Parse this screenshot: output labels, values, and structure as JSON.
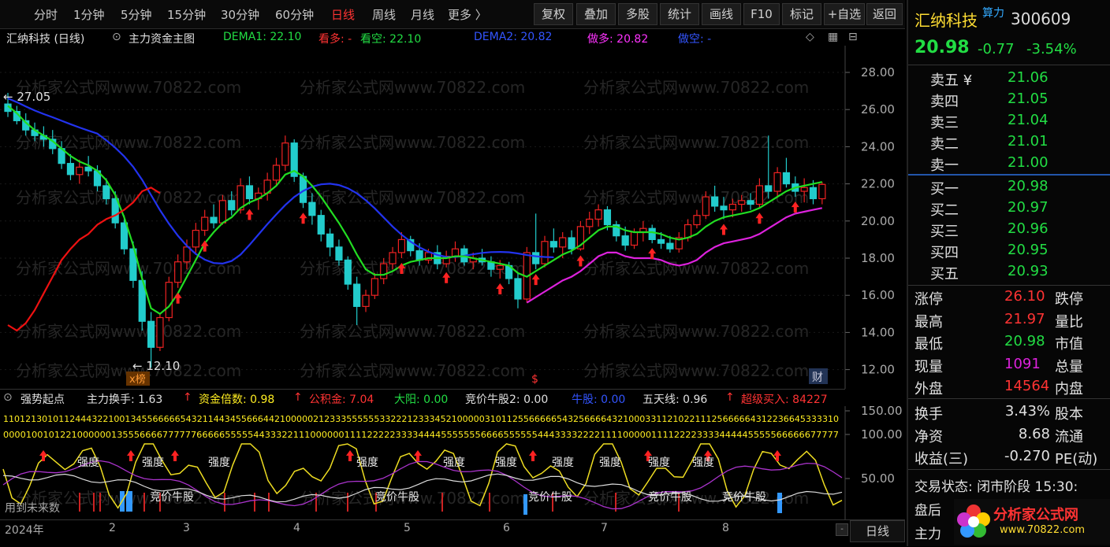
{
  "toolbar": {
    "periods": [
      "分时",
      "1分钟",
      "5分钟",
      "15分钟",
      "30分钟",
      "60分钟",
      "日线",
      "周线",
      "月线",
      "更多 〉"
    ],
    "active_period": "日线",
    "buttons": [
      "复权",
      "叠加",
      "多股",
      "统计",
      "画线",
      "F10",
      "标记",
      "+自选",
      "返回"
    ]
  },
  "chart_header": {
    "stock": "汇纳科技 (日线)",
    "formula": "主力资金主图",
    "dema1": "DEMA1: 22.10",
    "kanduo": "看多: -",
    "kankong": "看空: 22.10",
    "dema2": "DEMA2: 20.82",
    "zuoduo": "做多: 20.82",
    "zuokong": "做空: -"
  },
  "watermark": "分析家公式网www.70822.com",
  "chart_data": {
    "type": "candlestick",
    "y_ticks": [
      "28.00",
      "26.00",
      "24.00",
      "22.00",
      "20.00",
      "18.00",
      "16.00",
      "14.00",
      "12.00"
    ],
    "ylim": [
      11.3,
      29.4
    ],
    "annotations": {
      "high": "27.05",
      "low": "12.10"
    },
    "x_labels": [
      "2024年",
      "2",
      "3",
      "4",
      "5",
      "6",
      "7",
      "8"
    ],
    "ohlc": [
      [
        26.3,
        26.9,
        25.6,
        25.9
      ],
      [
        25.9,
        26.2,
        25.2,
        25.4
      ],
      [
        25.4,
        25.8,
        24.6,
        24.9
      ],
      [
        24.9,
        25.3,
        24.3,
        24.6
      ],
      [
        24.6,
        25.1,
        24.0,
        24.4
      ],
      [
        24.4,
        24.9,
        23.6,
        23.9
      ],
      [
        23.9,
        24.3,
        22.8,
        23.1
      ],
      [
        23.1,
        23.6,
        22.2,
        22.5
      ],
      [
        22.5,
        23.3,
        22.0,
        22.9
      ],
      [
        22.9,
        23.5,
        22.4,
        22.7
      ],
      [
        22.7,
        23.0,
        21.6,
        21.9
      ],
      [
        21.9,
        22.3,
        20.9,
        21.2
      ],
      [
        21.2,
        21.6,
        19.6,
        19.9
      ],
      [
        19.9,
        20.3,
        18.2,
        18.5
      ],
      [
        18.5,
        18.9,
        16.4,
        16.8
      ],
      [
        16.8,
        17.3,
        14.1,
        14.6
      ],
      [
        14.6,
        15.1,
        12.1,
        13.2
      ],
      [
        13.2,
        15.0,
        13.0,
        14.8
      ],
      [
        14.8,
        17.0,
        14.6,
        16.7
      ],
      [
        16.7,
        18.2,
        16.4,
        17.8
      ],
      [
        17.8,
        19.0,
        17.4,
        18.6
      ],
      [
        18.6,
        19.9,
        18.3,
        19.5
      ],
      [
        19.5,
        20.6,
        19.2,
        20.2
      ],
      [
        20.2,
        20.9,
        19.6,
        19.9
      ],
      [
        19.9,
        21.4,
        19.8,
        21.1
      ],
      [
        21.1,
        21.6,
        20.3,
        20.6
      ],
      [
        20.6,
        22.3,
        20.4,
        21.9
      ],
      [
        21.9,
        22.4,
        20.9,
        21.2
      ],
      [
        21.2,
        21.8,
        20.6,
        21.5
      ],
      [
        21.5,
        22.6,
        21.1,
        22.2
      ],
      [
        22.2,
        23.4,
        21.9,
        23.0
      ],
      [
        23.0,
        24.6,
        22.7,
        24.2
      ],
      [
        24.2,
        24.4,
        22.1,
        22.4
      ],
      [
        22.4,
        22.6,
        20.7,
        21.0
      ],
      [
        21.0,
        21.5,
        19.8,
        20.3
      ],
      [
        20.3,
        20.6,
        18.9,
        19.3
      ],
      [
        19.3,
        19.6,
        18.1,
        18.6
      ],
      [
        18.6,
        19.0,
        17.6,
        17.9
      ],
      [
        17.9,
        18.1,
        16.3,
        16.6
      ],
      [
        16.6,
        17.0,
        14.4,
        15.4
      ],
      [
        15.4,
        16.3,
        15.1,
        16.0
      ],
      [
        16.0,
        17.2,
        15.8,
        16.9
      ],
      [
        16.9,
        18.0,
        16.6,
        17.7
      ],
      [
        17.7,
        18.6,
        17.4,
        18.3
      ],
      [
        18.3,
        19.4,
        18.0,
        19.0
      ],
      [
        19.0,
        19.2,
        18.1,
        18.4
      ],
      [
        18.4,
        18.8,
        17.6,
        17.9
      ],
      [
        17.9,
        18.5,
        17.7,
        18.3
      ],
      [
        18.3,
        18.7,
        17.4,
        17.7
      ],
      [
        17.7,
        18.4,
        17.5,
        18.1
      ],
      [
        18.1,
        18.9,
        17.8,
        18.5
      ],
      [
        18.5,
        18.7,
        17.6,
        17.8
      ],
      [
        17.8,
        18.3,
        17.4,
        18.0
      ],
      [
        18.0,
        18.5,
        17.6,
        17.8
      ],
      [
        17.8,
        18.1,
        17.0,
        17.4
      ],
      [
        17.4,
        17.9,
        16.9,
        17.6
      ],
      [
        17.6,
        17.8,
        16.6,
        16.9
      ],
      [
        16.9,
        17.2,
        15.3,
        15.8
      ],
      [
        15.8,
        18.6,
        15.6,
        18.3
      ],
      [
        18.3,
        20.4,
        17.4,
        17.7
      ],
      [
        17.7,
        19.2,
        17.5,
        18.9
      ],
      [
        18.9,
        19.6,
        18.3,
        18.6
      ],
      [
        18.6,
        19.4,
        18.0,
        19.1
      ],
      [
        19.1,
        19.5,
        18.2,
        18.5
      ],
      [
        18.5,
        20.0,
        18.4,
        19.7
      ],
      [
        19.7,
        20.5,
        19.3,
        20.1
      ],
      [
        20.1,
        20.9,
        19.7,
        20.6
      ],
      [
        20.6,
        20.8,
        19.5,
        19.8
      ],
      [
        19.8,
        20.0,
        18.9,
        19.2
      ],
      [
        19.2,
        19.7,
        18.4,
        18.7
      ],
      [
        18.7,
        19.6,
        18.5,
        19.4
      ],
      [
        19.4,
        20.0,
        18.9,
        19.6
      ],
      [
        19.6,
        19.8,
        18.8,
        19.0
      ],
      [
        19.0,
        19.4,
        18.5,
        18.8
      ],
      [
        18.8,
        19.2,
        18.3,
        18.5
      ],
      [
        18.5,
        19.4,
        18.3,
        19.1
      ],
      [
        19.1,
        20.1,
        18.9,
        19.8
      ],
      [
        19.8,
        20.6,
        19.6,
        20.3
      ],
      [
        20.3,
        21.6,
        20.1,
        21.3
      ],
      [
        21.3,
        21.9,
        20.5,
        20.8
      ],
      [
        20.8,
        21.3,
        20.1,
        20.6
      ],
      [
        20.6,
        21.2,
        20.2,
        20.9
      ],
      [
        20.9,
        21.4,
        20.5,
        21.1
      ],
      [
        21.1,
        21.5,
        20.6,
        20.9
      ],
      [
        20.9,
        22.3,
        20.7,
        21.9
      ],
      [
        21.9,
        24.6,
        21.2,
        21.6
      ],
      [
        21.6,
        22.9,
        21.3,
        22.6
      ],
      [
        22.6,
        23.4,
        21.8,
        22.0
      ],
      [
        22.0,
        22.4,
        21.3,
        21.6
      ],
      [
        21.6,
        22.3,
        21.0,
        21.8
      ],
      [
        21.8,
        22.2,
        20.9,
        21.2
      ],
      [
        21.2,
        22.1,
        20.9,
        21.97
      ]
    ],
    "dema1": [
      26.2,
      25.8,
      25.3,
      24.9,
      24.6,
      24.3,
      23.9,
      23.5,
      23.2,
      23.0,
      22.7,
      22.2,
      21.4,
      20.2,
      18.7,
      16.9,
      15.3,
      15.0,
      15.4,
      16.1,
      17.0,
      17.9,
      18.8,
      19.4,
      19.9,
      20.2,
      20.7,
      21.0,
      21.2,
      21.5,
      21.9,
      22.5,
      22.7,
      22.4,
      21.9,
      21.3,
      20.6,
      19.9,
      19.1,
      18.2,
      17.4,
      17.1,
      17.1,
      17.3,
      17.6,
      17.8,
      17.9,
      18.0,
      18.0,
      18.0,
      18.1,
      18.1,
      18.0,
      17.9,
      17.8,
      17.7,
      17.6,
      17.2,
      17.0,
      17.3,
      17.6,
      17.9,
      18.2,
      18.4,
      18.7,
      19.1,
      19.5,
      19.7,
      19.7,
      19.5,
      19.4,
      19.4,
      19.4,
      19.3,
      19.1,
      19.0,
      19.1,
      19.3,
      19.7,
      20.0,
      20.2,
      20.3,
      20.4,
      20.5,
      20.7,
      21.0,
      21.3,
      21.6,
      21.8,
      21.9,
      22.0,
      22.1
    ]
  },
  "indicator_header": {
    "name": "强势起点",
    "zhuli": "主力换手: 1.63",
    "zijin": "资金倍数: 0.98",
    "gongji": "公积金: 7.04",
    "dayang": "大阳: 0.00",
    "jingjia": "竞价牛股2: 0.00",
    "niugu": "牛股: 0.00",
    "wutian": "五天线: 0.96",
    "chaoji": "超级买入: 84227"
  },
  "indicator": {
    "y_ticks": [
      "150.00",
      "100.00",
      "50.00"
    ],
    "top_row_1": "1101213010112444322100134556666654321144345566644210000021233355555533222123334521000003101125566666543256666432100033112102211125666664312236645333310",
    "top_row_2": "000010010122100000013555666677777766666555554433322111000000111122222333344445555555666655555544433332222111100000111122223333444445555566666677777",
    "labels": [
      "强度",
      "强度",
      "强度",
      "强度",
      "强度",
      "强度",
      "强度",
      "强度",
      "强度",
      "强度"
    ],
    "texts": [
      "竞价牛股",
      "竞价牛股",
      "竞价牛股",
      "竞价牛股",
      "竞价牛股"
    ],
    "bottom_label": "用到未来数"
  },
  "side": {
    "name": "汇纳科技",
    "code": "300609",
    "badge": "算力",
    "price": "20.98",
    "change": "-0.77",
    "pct": "-3.54%",
    "asks": [
      {
        "label": "卖五 ¥",
        "price": "21.06"
      },
      {
        "label": "卖四",
        "price": "21.05"
      },
      {
        "label": "卖三",
        "price": "21.04"
      },
      {
        "label": "卖二",
        "price": "21.01"
      },
      {
        "label": "卖一",
        "price": "21.00"
      }
    ],
    "bids": [
      {
        "label": "买一",
        "price": "20.98"
      },
      {
        "label": "买二",
        "price": "20.97"
      },
      {
        "label": "买三",
        "price": "20.96"
      },
      {
        "label": "买四",
        "price": "20.95"
      },
      {
        "label": "买五",
        "price": "20.93"
      }
    ],
    "stats": [
      {
        "label": "涨停",
        "value": "26.10",
        "color": "#ff3333",
        "label2": "跌停"
      },
      {
        "label": "最高",
        "value": "21.97",
        "color": "#ff3333",
        "label2": "量比"
      },
      {
        "label": "最低",
        "value": "20.98",
        "color": "#22dd44",
        "label2": "市值"
      },
      {
        "label": "现量",
        "value": "1091",
        "color": "#dd22dd",
        "label2": "总量"
      },
      {
        "label": "外盘",
        "value": "14564",
        "color": "#ff3333",
        "label2": "内盘"
      }
    ],
    "stats2": [
      {
        "label": "换手",
        "value": "3.43%",
        "label2": "股本"
      },
      {
        "label": "净资",
        "value": "8.68",
        "label2": "流通"
      },
      {
        "label": "收益(三)",
        "value": "-0.270",
        "label2": "PE(动)"
      }
    ],
    "trade_status": "交易状态: 闭市阶段 15:30:",
    "panhou": "盘后",
    "zhuli": "主力"
  },
  "bottom": {
    "period_btn": "日线"
  },
  "logo": {
    "title": "分析家公式网",
    "url": "www.70822.com"
  }
}
